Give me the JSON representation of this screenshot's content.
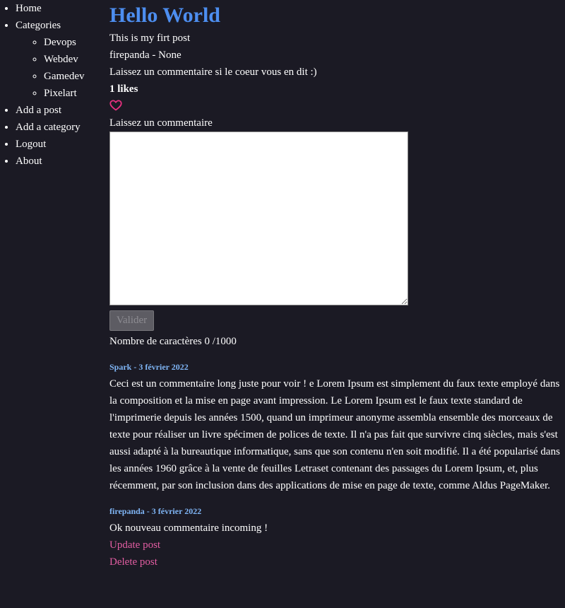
{
  "nav": {
    "home": "Home",
    "categories": "Categories",
    "category_items": [
      "Devops",
      "Webdev",
      "Gamedev",
      "Pixelart"
    ],
    "add_post": "Add a post",
    "add_category": "Add a category",
    "logout": "Logout",
    "about": "About"
  },
  "post": {
    "title": "Hello World",
    "body": "This is my firt post",
    "meta": "firepanda - None",
    "prompt": "Laissez un commentaire si le coeur vous en dit :)",
    "likes": "1 likes"
  },
  "comment_form": {
    "label": "Laissez un commentaire",
    "value": "",
    "submit_label": "Valider",
    "char_count": "Nombre de caractères 0 /1000"
  },
  "comments": [
    {
      "meta": "Spark - 3 février 2022",
      "body": "Ceci est un commentaire long juste pour voir ! e Lorem Ipsum est simplement du faux texte employé dans la composition et la mise en page avant impression. Le Lorem Ipsum est le faux texte standard de l'imprimerie depuis les années 1500, quand un imprimeur anonyme assembla ensemble des morceaux de texte pour réaliser un livre spécimen de polices de texte. Il n'a pas fait que survivre cinq siècles, mais s'est aussi adapté à la bureautique informatique, sans que son contenu n'en soit modifié. Il a été popularisé dans les années 1960 grâce à la vente de feuilles Letraset contenant des passages du Lorem Ipsum, et, plus récemment, par son inclusion dans des applications de mise en page de texte, comme Aldus PageMaker."
    },
    {
      "meta": "firepanda - 3 février 2022",
      "body": "Ok nouveau commentaire incoming !"
    }
  ],
  "actions": {
    "update": "Update post",
    "delete": "Delete post"
  },
  "colors": {
    "background": "#1b1a24",
    "title": "#4d8ef0",
    "comment_meta": "#7fb5f5",
    "link": "#e45ea3",
    "heart": "#e8307f"
  },
  "icons": {
    "like": "heart-outline-icon"
  }
}
